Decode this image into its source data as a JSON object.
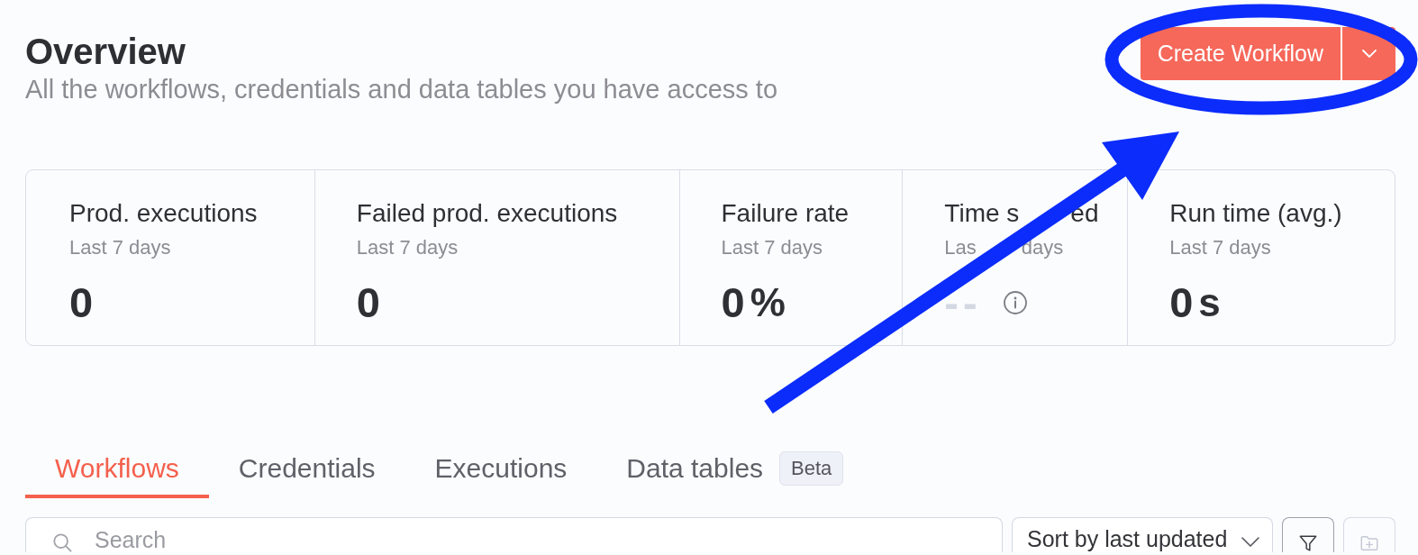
{
  "header": {
    "title": "Overview",
    "subtitle": "All the workflows, credentials and data tables you have access to",
    "create_button": {
      "label": "Create Workflow",
      "annotation_ellipse": true,
      "annotation_arrow": true
    }
  },
  "stats": [
    {
      "kind": "number",
      "label": "Prod. executions",
      "period": "Last 7 days",
      "value": "0"
    },
    {
      "kind": "number",
      "label": "Failed prod. executions",
      "period": "Last 7 days",
      "value": "0"
    },
    {
      "kind": "number",
      "label": "Failure rate",
      "period": "Last 7 days",
      "value": "0",
      "unit": "%"
    },
    {
      "kind": "empty",
      "label_parts": [
        "Time s",
        "ed"
      ],
      "period_parts": [
        "Las",
        "days"
      ],
      "value": "--"
    },
    {
      "kind": "number",
      "label": "Run time (avg.)",
      "period": "Last 7 days",
      "value": "0",
      "unit": "s"
    }
  ],
  "tabs": [
    {
      "label": "Workflows",
      "selected": true
    },
    {
      "label": "Credentials",
      "selected": false
    },
    {
      "label": "Executions",
      "selected": false
    },
    {
      "label": "Data tables",
      "selected": false,
      "badge": "Beta"
    }
  ],
  "toolbar": {
    "search": {
      "placeholder": "Search"
    },
    "sort": {
      "value": "Sort by last updated"
    },
    "icon_buttons": [
      {
        "kind": "filter",
        "disabled": false
      },
      {
        "kind": "new-folder",
        "disabled": true
      }
    ]
  }
}
